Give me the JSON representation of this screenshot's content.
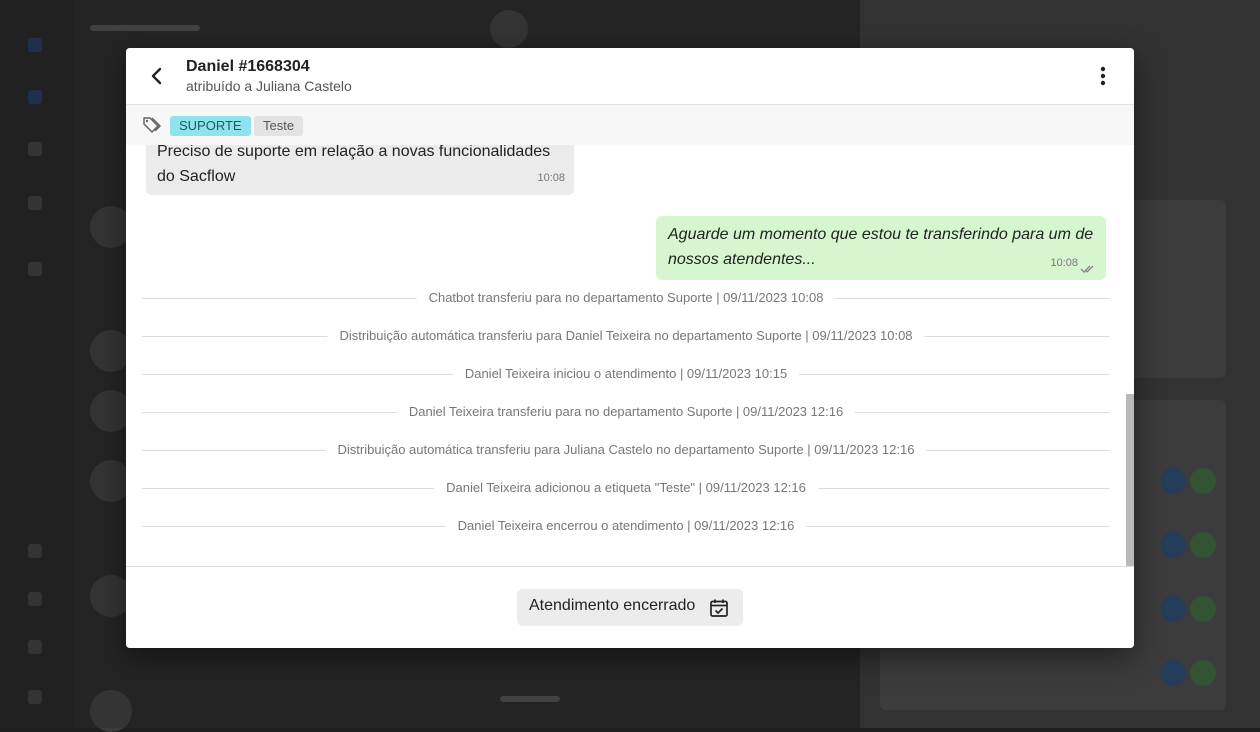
{
  "conversation": {
    "title": "Daniel #1668304",
    "subtitle": "atribuído a Juliana Castelo"
  },
  "tags": [
    "SUPORTE",
    "Teste"
  ],
  "messages": [
    {
      "direction": "incoming",
      "text": "Preciso de suporte em relação a novas funcionalidades do Sacflow",
      "time": "10:08"
    },
    {
      "direction": "outgoing",
      "text": "Aguarde um momento que estou te transferindo para um de nossos atendentes...",
      "time": "10:08",
      "status": "read"
    }
  ],
  "events": [
    "Chatbot transferiu para no departamento Suporte | 09/11/2023 10:08",
    "Distribuição automática transferiu para Daniel Teixeira no departamento Suporte | 09/11/2023 10:08",
    "Daniel Teixeira iniciou o atendimento | 09/11/2023 10:15",
    "Daniel Teixeira transferiu para no departamento Suporte | 09/11/2023 12:16",
    "Distribuição automática transferiu para Juliana Castelo no departamento Suporte | 09/11/2023 12:16",
    "Daniel Teixeira adicionou a etiqueta \"Teste\" | 09/11/2023 12:16",
    "Daniel Teixeira encerrou o atendimento | 09/11/2023 12:16"
  ],
  "footer": {
    "status_label": "Atendimento encerrado"
  },
  "icons": {
    "back": "chevron-left-icon",
    "menu": "more-vertical-icon",
    "tags": "tag-icon",
    "read_receipt": "double-check-icon",
    "closed": "calendar-check-icon"
  },
  "colors": {
    "tag_suporte_bg": "#8ee3ec",
    "tag_teste_bg": "#e3e3e3",
    "incoming_bubble": "#ebebeb",
    "outgoing_bubble": "#d6f6d0"
  }
}
